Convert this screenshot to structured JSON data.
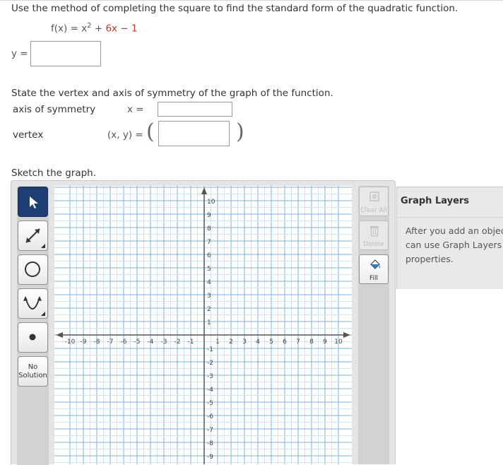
{
  "question": {
    "prompt": "Use the method of completing the square to find the standard form of the quadratic function.",
    "function_lhs": "f(x) = x",
    "function_exponent": "2",
    "function_plus": " + ",
    "function_term_b": "6x",
    "function_minus": " − ",
    "function_term_c": "1",
    "y_label": "y ="
  },
  "vertex_section": {
    "prompt": "State the vertex and axis of symmetry of the graph of the function.",
    "axis_label": "axis of symmetry",
    "axis_eq_label": "x =",
    "vertex_label": "vertex",
    "vertex_eq_label": "(x, y) =",
    "open_paren": "(",
    "close_paren": ")"
  },
  "sketch": {
    "prompt": "Sketch the graph."
  },
  "tools": {
    "no_solution_line1": "No",
    "no_solution_line2": "Solution"
  },
  "actions": {
    "clear_all": "Clear All",
    "delete": "Delete",
    "fill": "Fill"
  },
  "layers": {
    "title": "Graph Layers",
    "line1": "After you add an object t",
    "line2": "can use Graph Layers to",
    "line3": "properties."
  },
  "graph": {
    "x_min": -10,
    "x_max": 10,
    "y_min": -10,
    "y_max": 10,
    "minor_step": 0.5,
    "major_step": 1,
    "grid_major_color": "#7fb3d5",
    "grid_minor_color": "#cfe3f0",
    "axis_color": "#555555"
  }
}
